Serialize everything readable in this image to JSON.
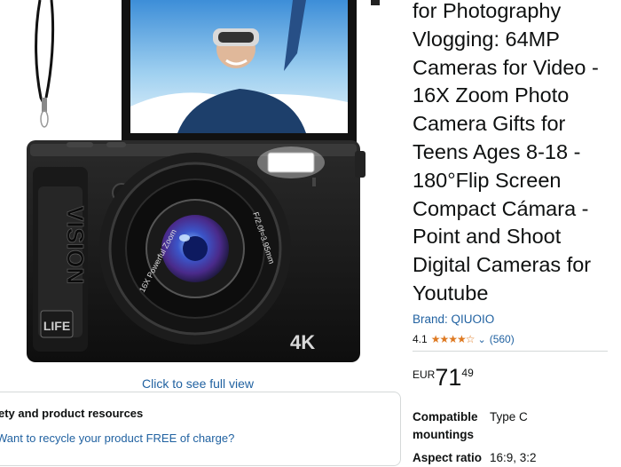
{
  "product": {
    "title": "for Photography Vlogging: 64MP Cameras for Video - 16X Zoom Photo Camera Gifts for Teens Ages 8-18 - 180°Flip Screen Compact Cámara - Point and Shoot Digital Cameras for Youtube",
    "brand": "Brand: QIUOIO",
    "rating": "4.1",
    "rating_value": 4.1,
    "review_count": "(560)",
    "price": {
      "currency": "EUR",
      "whole": "71",
      "fraction": "49"
    },
    "specs": [
      {
        "key": "Compatible mountings",
        "value": "Type C"
      },
      {
        "key": "Aspect ratio",
        "value": "16:9, 3:2"
      }
    ]
  },
  "gallery": {
    "click_full_view": "Click to see full view",
    "lens_text_left": "16X Powerful Zoom",
    "lens_text_right": "F/2.0f=3.95mm",
    "grip_brand": "VISION",
    "grip_badge": "LIFE",
    "badge_4k": "4K"
  },
  "resources": {
    "title": "ety and product resources",
    "link": "Want to recycle your product FREE of charge?"
  },
  "colors": {
    "link": "#2162a1",
    "star": "#de7921",
    "text": "#0f1111"
  }
}
